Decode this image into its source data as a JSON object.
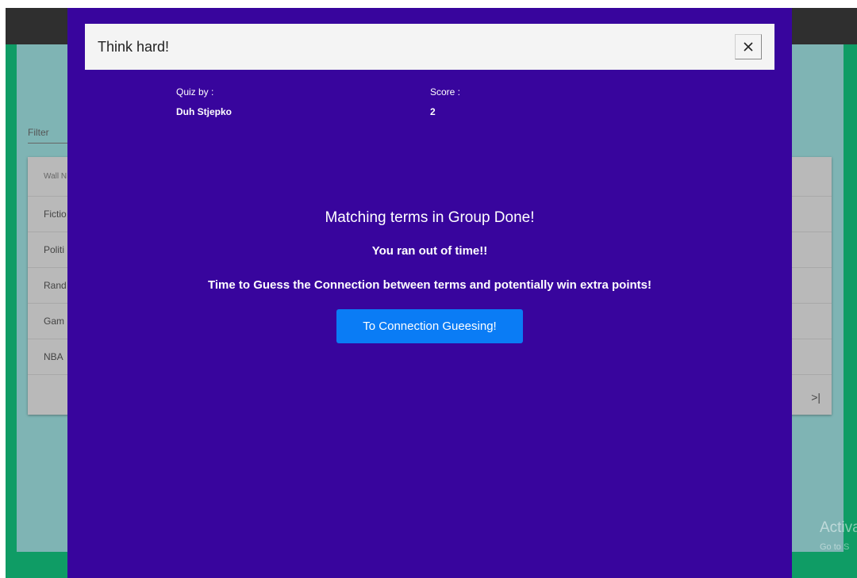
{
  "background": {
    "filter_label": "Filter",
    "table": {
      "header": "Wall N",
      "rows": [
        "Fictio",
        "Politi",
        "Rand",
        "Gam",
        "NBA"
      ],
      "pager_last_icon": ">|"
    },
    "watermark": {
      "line1": "Activa",
      "line2": "Go to S"
    }
  },
  "modal": {
    "title": "Think hard!",
    "close_icon": "×",
    "quiz_by_label": "Quiz by :",
    "quiz_by_value": "Duh Stjepko",
    "score_label": "Score :",
    "score_value": "2",
    "heading": "Matching terms in Group Done!",
    "message1": "You ran out of time!!",
    "message2": "Time to Guess the Connection between terms and potentially win extra points!",
    "cta_label": "To Connection Gueesing!"
  },
  "colors": {
    "modal_bg": "#38059d",
    "cta_bg": "#0a7cf5",
    "app_green": "#0f9c65",
    "panel_teal": "#7fb4b4"
  }
}
